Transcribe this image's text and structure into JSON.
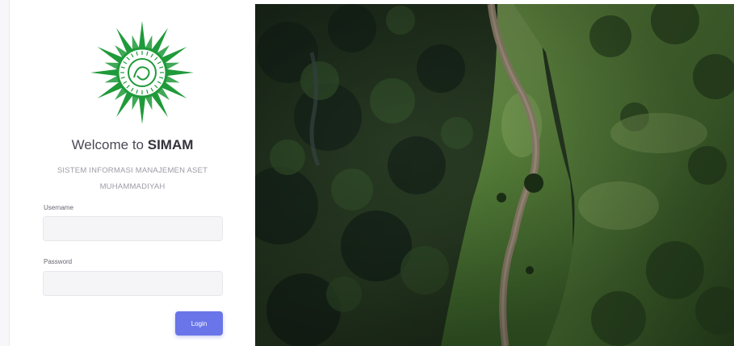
{
  "colors": {
    "accent": "#6975e8",
    "logo_green": "#1f9a3a",
    "input_bg": "#f5f5f8"
  },
  "logo": {
    "icon": "muhammadiyah-sun-emblem"
  },
  "welcome": {
    "prefix": "Welcome to",
    "app_name": "SIMAM"
  },
  "subtitle": "SISTEM INFORMASI MANAJEMEN ASET MUHAMMADIYAH",
  "form": {
    "username_label": "Username",
    "username_value": "",
    "password_label": "Password",
    "password_value": "",
    "login_label": "Login"
  },
  "hero": {
    "image": "aerial-green-ridge-with-footpath"
  }
}
